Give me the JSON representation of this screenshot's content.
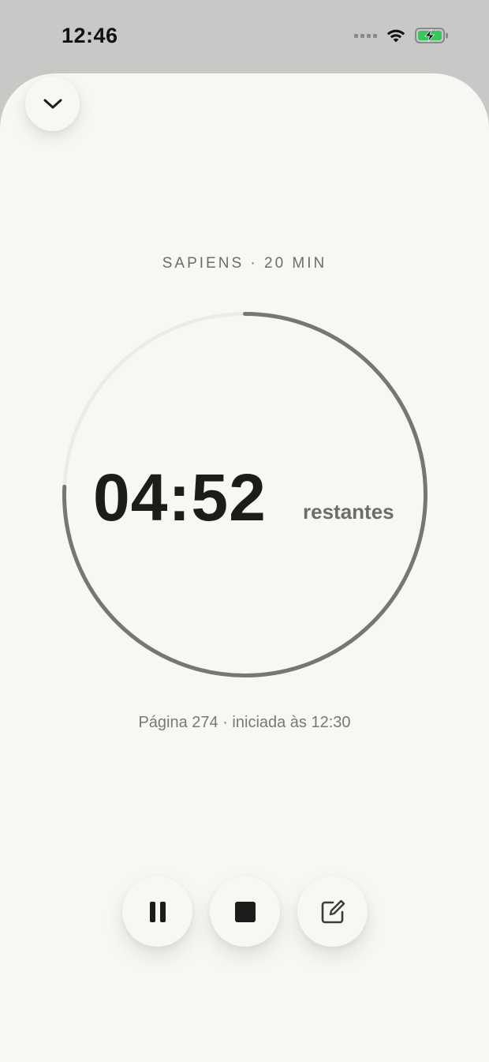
{
  "status_bar": {
    "time": "12:46",
    "icons": [
      "signal-icon",
      "wifi-icon",
      "battery-charging-icon"
    ],
    "battery_color": "#34c759"
  },
  "header": {
    "collapse_icon": "chevron-down-icon"
  },
  "session": {
    "label": "SAPIENS · 20 MIN",
    "time_remaining": "04:52",
    "remaining_suffix": "restantes",
    "info": "Página 274 · iniciada às 12:30",
    "progress_fraction": 0.757
  },
  "controls": [
    {
      "name": "pause-button",
      "icon": "pause-icon"
    },
    {
      "name": "stop-button",
      "icon": "stop-icon"
    },
    {
      "name": "note-button",
      "icon": "edit-note-icon"
    }
  ],
  "colors": {
    "background": "#f8f7f4",
    "status_bar_bg": "#c9c8c6",
    "ring_progress": "#777673",
    "ring_track": "#ecebe8",
    "text_primary": "#1d1c1a",
    "text_secondary": "#6e6c68"
  }
}
